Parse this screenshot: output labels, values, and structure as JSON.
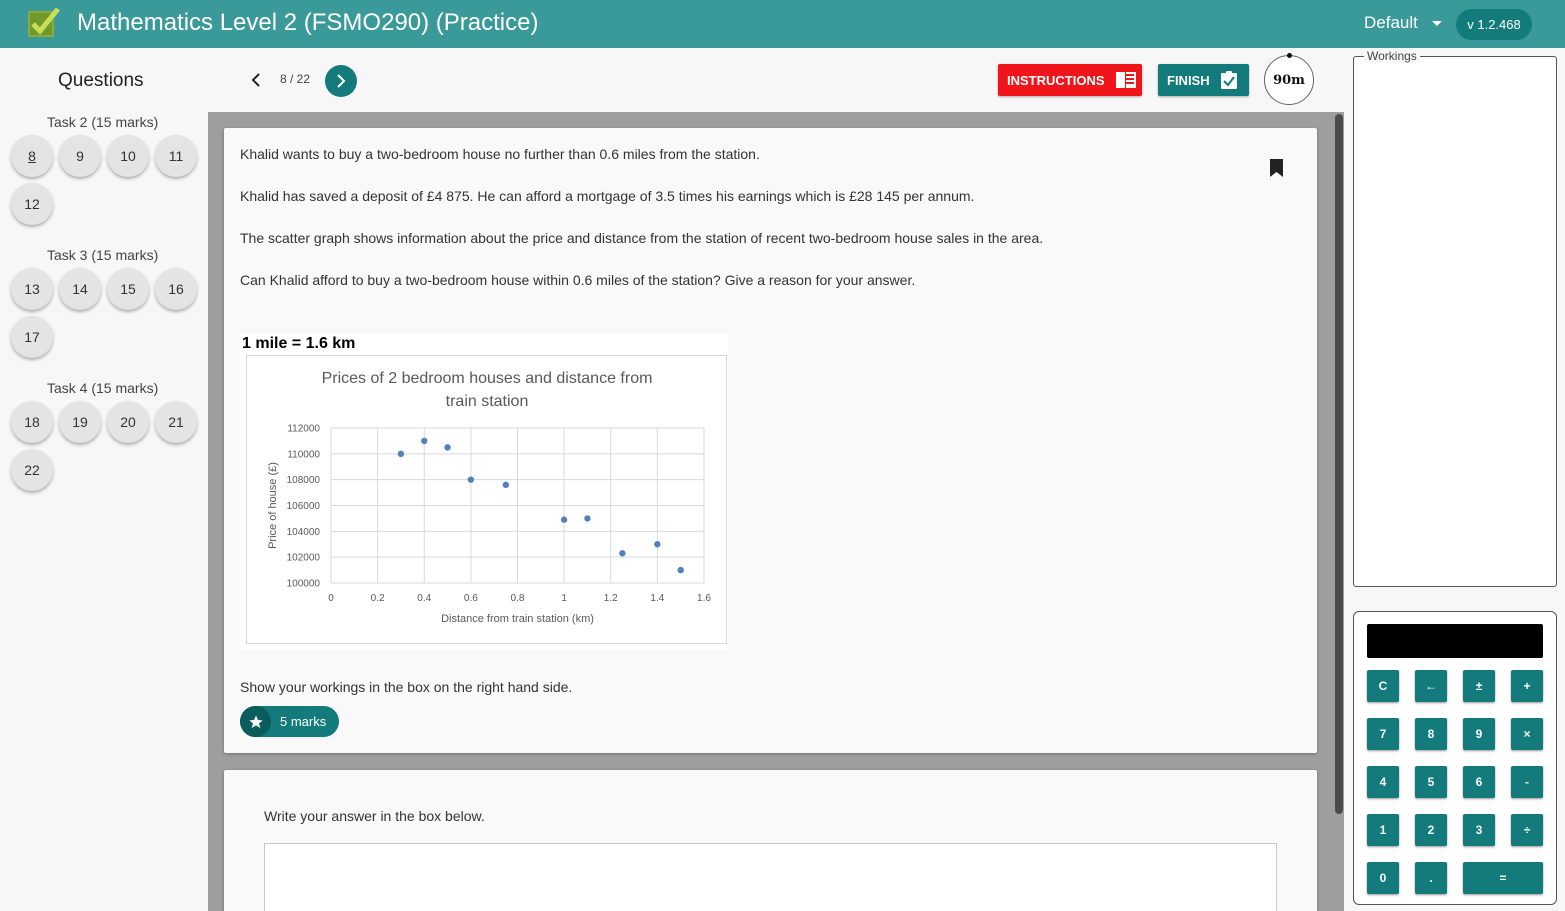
{
  "header": {
    "title": "Mathematics Level 2 (FSMO290) (Practice)",
    "profile": "Default",
    "version": "v 1.2.468"
  },
  "sidebar": {
    "title": "Questions",
    "tasks": [
      {
        "label": "Task 2 (15 marks)",
        "questions": [
          "8",
          "9",
          "10",
          "11",
          "12"
        ]
      },
      {
        "label": "Task 3 (15 marks)",
        "questions": [
          "13",
          "14",
          "15",
          "16",
          "17"
        ]
      },
      {
        "label": "Task 4 (15 marks)",
        "questions": [
          "18",
          "19",
          "20",
          "21",
          "22"
        ]
      }
    ],
    "current_question": "8"
  },
  "nav": {
    "count": "8 / 22",
    "instructions_label": "INSTRUCTIONS",
    "finish_label": "FINISH",
    "timer": "90m"
  },
  "question": {
    "paragraphs": [
      "Khalid wants to buy a two-bedroom house no further than 0.6 miles from the station.",
      "Khalid has saved a deposit of £4 875. He can afford a mortgage of 3.5 times his earnings which is £28 145 per annum.",
      "The scatter graph shows information about the price and distance from the station of recent two-bedroom house sales in the area.",
      "Can Khalid afford to buy a two-bedroom house within 0.6 miles of the station? Give a reason for your answer."
    ],
    "conversion_note": "1 mile = 1.6 km",
    "show_workings": "Show your workings in the box on the right hand side.",
    "marks": "5 marks"
  },
  "answer": {
    "instruction": "Write your answer in the box below."
  },
  "workings": {
    "label": "Workings"
  },
  "calculator": {
    "keys": [
      "C",
      "←",
      "±",
      "+",
      "7",
      "8",
      "9",
      "×",
      "4",
      "5",
      "6",
      "-",
      "1",
      "2",
      "3",
      "÷",
      "0",
      ".",
      "="
    ]
  },
  "chart_data": {
    "type": "scatter",
    "title_lines": [
      "Prices of 2 bedroom houses and distance from",
      "train station"
    ],
    "xlabel": "Distance from train station (km)",
    "ylabel": "Price of house (£)",
    "xlim": [
      0,
      1.6
    ],
    "ylim": [
      100000,
      112000
    ],
    "x_ticks": [
      "0",
      "0.2",
      "0.4",
      "0.6",
      "0.8",
      "1",
      "1.2",
      "1.4",
      "1.6"
    ],
    "y_ticks": [
      "100000",
      "102000",
      "104000",
      "106000",
      "108000",
      "110000",
      "112000"
    ],
    "grid": true,
    "color": "#4f81bd",
    "points": [
      {
        "x": 0.3,
        "y": 110000
      },
      {
        "x": 0.4,
        "y": 111000
      },
      {
        "x": 0.5,
        "y": 110500
      },
      {
        "x": 0.6,
        "y": 108000
      },
      {
        "x": 0.75,
        "y": 107600
      },
      {
        "x": 1.0,
        "y": 104900
      },
      {
        "x": 1.1,
        "y": 105000
      },
      {
        "x": 1.25,
        "y": 102300
      },
      {
        "x": 1.4,
        "y": 103000
      },
      {
        "x": 1.5,
        "y": 101000
      }
    ]
  }
}
